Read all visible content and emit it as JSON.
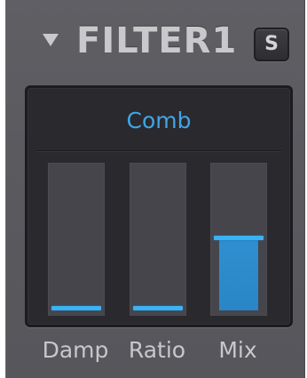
{
  "header": {
    "title": "FILTER1",
    "solo_label": "S",
    "collapse_icon": "triangle-down-icon"
  },
  "filter": {
    "mode": "Comb"
  },
  "sliders": [
    {
      "label": "Damp",
      "level": 0.0
    },
    {
      "label": "Ratio",
      "level": 0.0
    },
    {
      "label": "Mix",
      "level": 0.5
    }
  ],
  "colors": {
    "accent": "#3ea6e6",
    "handle": "#3bb2f2",
    "fill": "#2f8fd0",
    "panel": "#5a5a5f",
    "display": "#2a292e",
    "text": "#c8c8cb"
  }
}
